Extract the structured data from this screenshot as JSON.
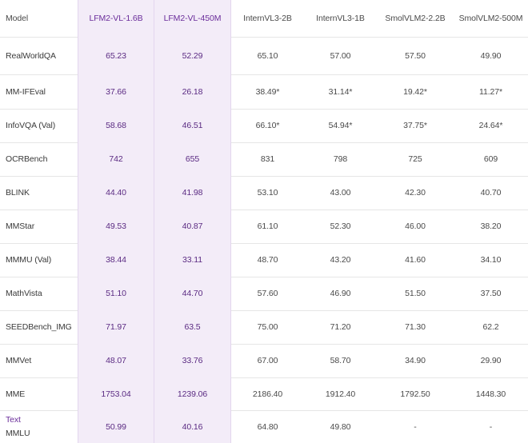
{
  "columns": [
    "Model",
    "LFM2-VL-1.6B",
    "LFM2-VL-450M",
    "InternVL3-2B",
    "InternVL3-1B",
    "SmolVLM2-2.2B",
    "SmolVLM2-500M"
  ],
  "rows": [
    {
      "name": "RealWorldQA",
      "values": [
        "65.23",
        "52.29",
        "65.10",
        "57.00",
        "57.50",
        "49.90"
      ]
    },
    {
      "name": "MM-IFEval",
      "values": [
        "37.66",
        "26.18",
        "38.49*",
        "31.14*",
        "19.42*",
        "11.27*"
      ]
    },
    {
      "name": "InfoVQA (Val)",
      "values": [
        "58.68",
        "46.51",
        "66.10*",
        "54.94*",
        "37.75*",
        "24.64*"
      ]
    },
    {
      "name": "OCRBench",
      "values": [
        "742",
        "655",
        "831",
        "798",
        "725",
        "609"
      ]
    },
    {
      "name": "BLINK",
      "values": [
        "44.40",
        "41.98",
        "53.10",
        "43.00",
        "42.30",
        "40.70"
      ]
    },
    {
      "name": "MMStar",
      "values": [
        "49.53",
        "40.87",
        "61.10",
        "52.30",
        "46.00",
        "38.20"
      ]
    },
    {
      "name": "MMMU (Val)",
      "values": [
        "38.44",
        "33.11",
        "48.70",
        "43.20",
        "41.60",
        "34.10"
      ]
    },
    {
      "name": "MathVista",
      "values": [
        "51.10",
        "44.70",
        "57.60",
        "46.90",
        "51.50",
        "37.50"
      ]
    },
    {
      "name": "SEEDBench_IMG",
      "values": [
        "71.97",
        "63.5",
        "75.00",
        "71.20",
        "71.30",
        "62.2"
      ]
    },
    {
      "name": "MMVet",
      "values": [
        "48.07",
        "33.76",
        "67.00",
        "58.70",
        "34.90",
        "29.90"
      ]
    },
    {
      "name": "MME",
      "values": [
        "1753.04",
        "1239.06",
        "2186.40",
        "1912.40",
        "1792.50",
        "1448.30"
      ]
    },
    {
      "name_accent": "Text",
      "name": "MMLU",
      "values": [
        "50.99",
        "40.16",
        "64.80",
        "49.80",
        "-",
        "-"
      ]
    }
  ],
  "colors": {
    "highlight_bg": "#f3ecf8",
    "highlight_text": "#5a2a82",
    "border": "#e6e6e6"
  }
}
